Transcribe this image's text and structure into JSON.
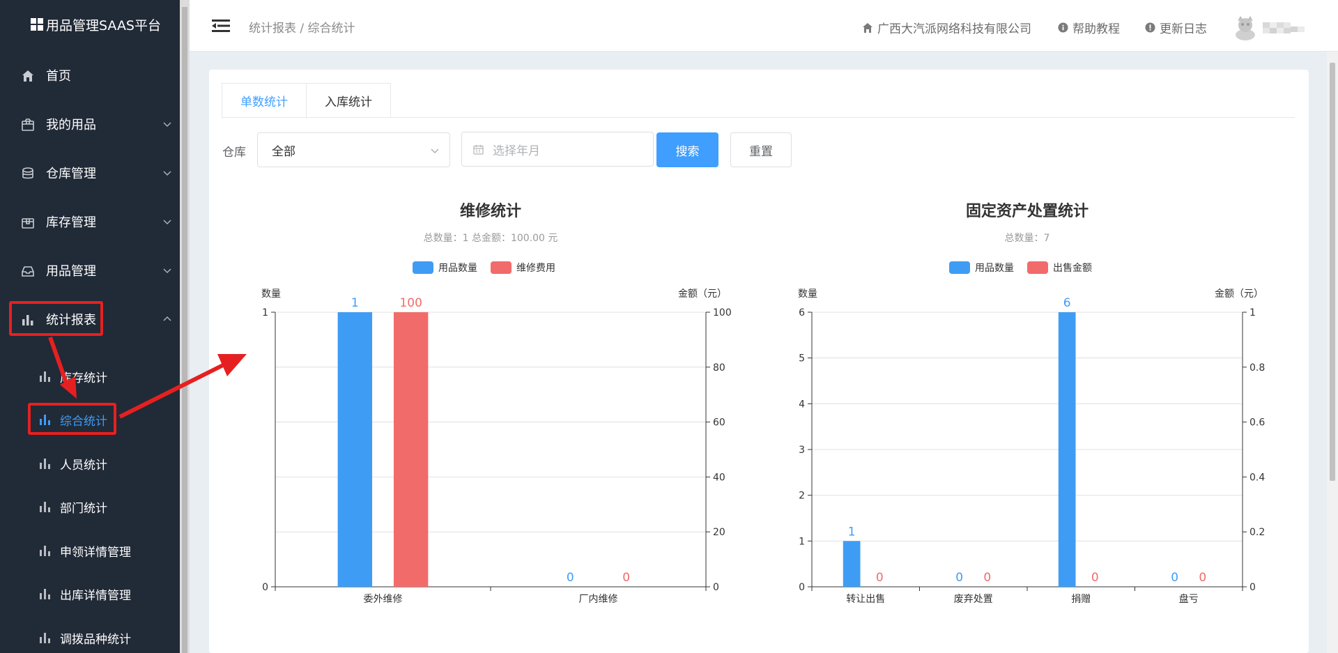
{
  "sidebar": {
    "logo": "用品管理SAAS平台",
    "items": [
      {
        "label": "首页"
      },
      {
        "label": "我的用品"
      },
      {
        "label": "仓库管理"
      },
      {
        "label": "库存管理"
      },
      {
        "label": "用品管理"
      },
      {
        "label": "统计报表"
      }
    ],
    "subitems": [
      {
        "label": "库存统计"
      },
      {
        "label": "综合统计"
      },
      {
        "label": "人员统计"
      },
      {
        "label": "部门统计"
      },
      {
        "label": "申领详情管理"
      },
      {
        "label": "出库详情管理"
      },
      {
        "label": "调拨品种统计"
      }
    ]
  },
  "header": {
    "breadcrumb": "统计报表 / 综合统计",
    "company": "广西大汽派网络科技有限公司",
    "help": "帮助教程",
    "changelog": "更新日志"
  },
  "tabs": [
    {
      "label": "单数统计"
    },
    {
      "label": "入库统计"
    }
  ],
  "filters": {
    "warehouse_label": "仓库",
    "warehouse_value": "全部",
    "date_placeholder": "选择年月",
    "search_label": "搜索",
    "reset_label": "重置"
  },
  "colors": {
    "accent": "#409eff",
    "blue": "#3f9cf5",
    "red": "#f26b6b",
    "sidebar": "#212a37",
    "highlight": "#e62020"
  },
  "chart_data": [
    {
      "type": "bar",
      "title": "维修统计",
      "subtitle": "总数量：1   总金额：100.00 元",
      "categories": [
        "委外维修",
        "厂内维修"
      ],
      "series": [
        {
          "name": "用品数量",
          "values": [
            1,
            0
          ],
          "axis": "left"
        },
        {
          "name": "维修费用",
          "values": [
            100,
            0
          ],
          "axis": "right"
        }
      ],
      "ylabel_left": "数量",
      "ylabel_right": "金额（元）",
      "ylim_left": [
        0,
        1
      ],
      "ylim_right": [
        0,
        100
      ],
      "yticks_left": [
        "0",
        "1"
      ],
      "yticks_right": [
        "0",
        "20",
        "40",
        "60",
        "80",
        "100"
      ],
      "legend": "top-center",
      "grid": true
    },
    {
      "type": "bar",
      "title": "固定资产处置统计",
      "subtitle": "总数量：7",
      "categories": [
        "转让出售",
        "废弃处置",
        "捐赠",
        "盘亏"
      ],
      "series": [
        {
          "name": "用品数量",
          "values": [
            1,
            0,
            6,
            0
          ],
          "axis": "left"
        },
        {
          "name": "出售金额",
          "values": [
            0,
            0,
            0,
            0
          ],
          "axis": "right"
        }
      ],
      "ylabel_left": "数量",
      "ylabel_right": "金额（元）",
      "ylim_left": [
        0,
        6
      ],
      "ylim_right": [
        0,
        1
      ],
      "yticks_left": [
        "0",
        "1",
        "2",
        "3",
        "4",
        "5",
        "6"
      ],
      "yticks_right": [
        "0",
        "0.2",
        "0.4",
        "0.6",
        "0.8",
        "1"
      ],
      "legend": "top-center",
      "grid": true
    }
  ]
}
